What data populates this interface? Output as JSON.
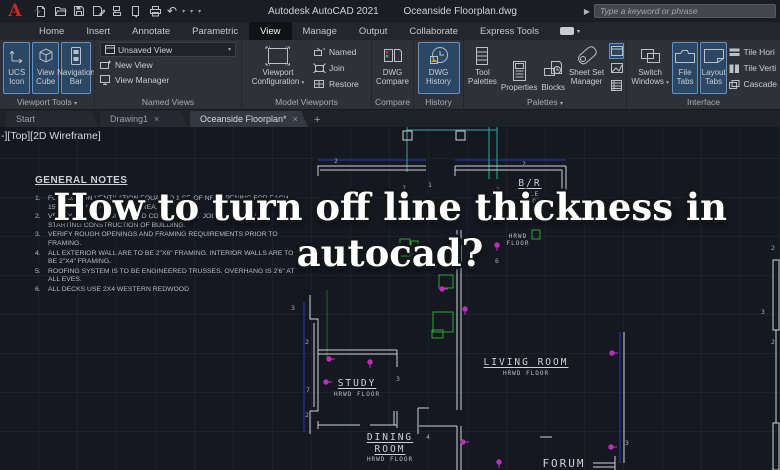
{
  "titlebar": {
    "app_title": "Autodesk AutoCAD 2021",
    "doc_title": "Oceanside Floorplan.dwg",
    "search_placeholder": "Type a keyword or phrase"
  },
  "ribbon": {
    "tabs": [
      "Home",
      "Insert",
      "Annotate",
      "Parametric",
      "View",
      "Manage",
      "Output",
      "Collaborate",
      "Express Tools"
    ],
    "active_tab": "View",
    "panels": {
      "viewport_tools": {
        "label": "Viewport Tools",
        "b1": [
          "UCS",
          "Icon"
        ],
        "b2": [
          "View",
          "Cube"
        ],
        "b3": [
          "Navigation",
          "Bar"
        ]
      },
      "named_views": {
        "label": "Named Views",
        "dropdown": "Unsaved View",
        "item1": "New View",
        "item2": "View Manager"
      },
      "model_viewports": {
        "label": "Model Viewports",
        "big": [
          "Viewport",
          "Configuration"
        ],
        "item1": "Named",
        "item2": "Join",
        "item3": "Restore"
      },
      "compare": {
        "label": "Compare",
        "big": [
          "DWG",
          "Compare"
        ]
      },
      "history": {
        "label": "History",
        "big": [
          "DWG",
          "History"
        ]
      },
      "palettes": {
        "label": "Palettes",
        "b1": [
          "Tool",
          "Palettes"
        ],
        "b2": "Properties",
        "b3": "Blocks",
        "b4": [
          "Sheet Set",
          "Manager"
        ]
      },
      "interface": {
        "label": "Interface",
        "b1": [
          "Switch",
          "Windows"
        ],
        "b2": [
          "File",
          "Tabs"
        ],
        "b3": [
          "Layout",
          "Tabs"
        ],
        "s1": "Tile Hori",
        "s2": "Tile Verti",
        "s3": "Cascade"
      }
    }
  },
  "file_tabs": {
    "start": "Start",
    "drawing1": "Drawing1",
    "active": "Oceanside Floorplan*",
    "close_glyph": "×",
    "new_tab": "+"
  },
  "viewport_controls": "-][Top][2D Wireframe]",
  "general_notes": {
    "heading": "GENERAL NOTES",
    "items": [
      "FOUNDATION VENTILATION EQUAL TO 1 SF. OF NET OPENING FOR EACH 150 S.F. OF UNDER FLOOR AREA.",
      "VERIFY ALL DIMENSIONS AND CONDITIONS AT JOB SITE PRIOR TO STARTING CONSTRUCTION OF BUILDING.",
      "VERIFY ROUGH OPENINGS AND FRAMING REQUIREMENTS PRIOR TO FRAMING.",
      "ALL EXTERIOR WALL ARE TO BE 2\"X6\" FRAMING. INTERIOR WALLS ARE TO BE 2\"X4\" FRAMING.",
      "ROOFING SYSTEM IS TO BE ENGINEERED TRUSSES. OVERHANG IS 2'6\" AT ALL EVES.",
      "ALL DECKS USE 2X4 WESTERN REDWOOD"
    ]
  },
  "overlay": {
    "title_line1": "How to turn off line thickness in",
    "title_line2": "autocad?"
  },
  "floorplan": {
    "rooms": {
      "br": "B/R",
      "br_sub1": "TILE",
      "br_sub2": "FLOOR",
      "hall_sub1": "HRWD",
      "hall_sub2": "FLOOR",
      "living": "LIVING ROOM",
      "living_sub": "HRWD FLOOR",
      "study": "STUDY",
      "study_sub": "HRWD FLOOR",
      "dining1": "DINING",
      "dining2": "ROOM",
      "dining_sub": "HRWD FLOOR",
      "forum": "FORUM"
    },
    "dims": [
      "2",
      "1",
      "2",
      "2",
      "2",
      "3",
      "2",
      "7",
      "2",
      "3",
      "4",
      "3",
      "6",
      "3",
      "2",
      "2"
    ]
  },
  "colors": {
    "accent_blue": "#5d93c9",
    "highlight_bg": "#2b4764",
    "wall_white": "#cdd2d6",
    "cad_teal": "#2e8f8a",
    "cad_green": "#2ea52e",
    "cad_magenta": "#b832b8",
    "dim_blue": "#2a3bb0",
    "drawing_bg": "#151821"
  }
}
